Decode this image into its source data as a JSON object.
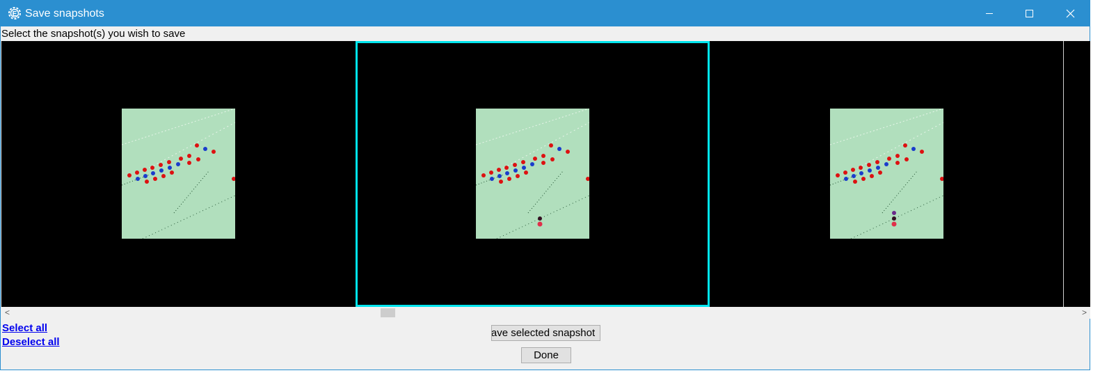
{
  "window": {
    "title": "Save snapshots",
    "app_icon": "gear-e-icon",
    "controls": [
      "minimize-icon",
      "maximize-icon",
      "close-icon"
    ],
    "accent_color": "#2b8fd0"
  },
  "instruction": "Select the snapshot(s) you wish to save",
  "snapshots": {
    "selected_index": 1,
    "selection_color": "#00e5ee",
    "background_color": "#000000",
    "thumbnail_color": "#b1dfbd",
    "items": [
      {
        "selected": false
      },
      {
        "selected": true
      },
      {
        "selected": false
      }
    ]
  },
  "scrollbar": {
    "left_arrow": "<",
    "right_arrow": ">"
  },
  "links": {
    "select_all": "Select all",
    "deselect_all": "Deselect all"
  },
  "buttons": {
    "save_selected": "ave selected snapshot",
    "done": "Done"
  }
}
